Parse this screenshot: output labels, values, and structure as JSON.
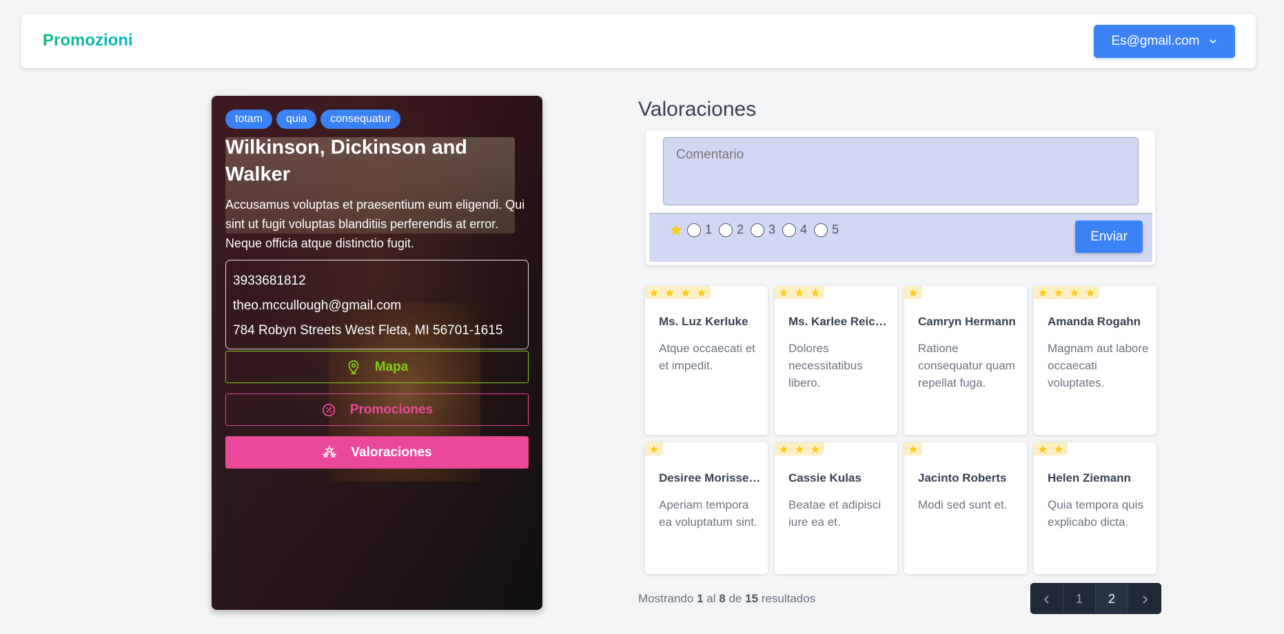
{
  "nav": {
    "brand": "Promozioni",
    "user_email": "Es@gmail.com"
  },
  "business": {
    "tags": [
      "totam",
      "quia",
      "consequatur"
    ],
    "name": "Wilkinson, Dickinson and Walker",
    "description": "Accusamus voluptas et praesentium eum eligendi. Qui sint ut fugit voluptas blanditiis perferendis at error. Neque officia atque distinctio fugit.",
    "phone": "3933681812",
    "email": "theo.mccullough@gmail.com",
    "address": "784 Robyn Streets West Fleta, MI 56701-1615",
    "buttons": {
      "map": "Mapa",
      "promotions": "Promociones",
      "reviews": "Valoraciones"
    }
  },
  "reviews_section": {
    "title": "Valoraciones",
    "comment_placeholder": "Comentario",
    "rating_options": [
      "1",
      "2",
      "3",
      "4",
      "5"
    ],
    "send_label": "Enviar",
    "colors": {
      "star": "#facc15",
      "accent": "#3b82f6",
      "pink": "#ec4899",
      "lime": "#84cc16"
    },
    "reviews": [
      {
        "name": "Ms. Luz Kerluke",
        "text": "Atque occaecati et et impedit.",
        "stars": 4
      },
      {
        "name": "Ms. Karlee Reichert",
        "text": "Dolores necessitatibus libero.",
        "stars": 3
      },
      {
        "name": "Camryn Hermann",
        "text": "Ratione consequatur quam repellat fuga.",
        "stars": 1
      },
      {
        "name": "Amanda Rogahn",
        "text": "Magnam aut labore occaecati voluptates.",
        "stars": 4
      },
      {
        "name": "Desiree Morissette",
        "text": "Aperiam tempora ea voluptatum sint.",
        "stars": 1
      },
      {
        "name": "Cassie Kulas",
        "text": "Beatae et adipisci iure ea et.",
        "stars": 3
      },
      {
        "name": "Jacinto Roberts",
        "text": "Modi sed sunt et.",
        "stars": 1
      },
      {
        "name": "Helen Ziemann",
        "text": "Quia tempora quis explicabo dicta.",
        "stars": 2
      }
    ],
    "results": {
      "prefix": "Mostrando",
      "from": "1",
      "al": "al",
      "to": "8",
      "de": "de",
      "total": "15",
      "suffix": "resultados"
    },
    "pages": [
      "1",
      "2"
    ],
    "current_page": "2"
  }
}
